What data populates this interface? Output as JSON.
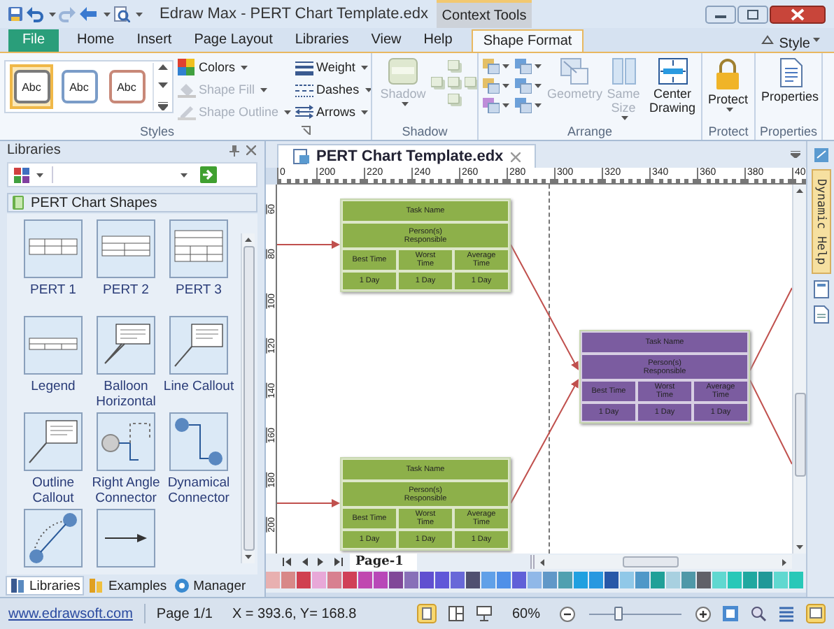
{
  "window": {
    "title": "Edraw Max - PERT Chart Template.edx",
    "context_tab": "Context Tools"
  },
  "ribbon_tabs": [
    {
      "label": "File",
      "kind": "file",
      "selected": false
    },
    {
      "label": "Home",
      "kind": "tab",
      "selected": false
    },
    {
      "label": "Insert",
      "kind": "tab",
      "selected": false
    },
    {
      "label": "Page Layout",
      "kind": "tab",
      "selected": false
    },
    {
      "label": "Libraries",
      "kind": "tab",
      "selected": false
    },
    {
      "label": "View",
      "kind": "tab",
      "selected": false
    },
    {
      "label": "Help",
      "kind": "tab",
      "selected": false
    },
    {
      "label": "Shape Format",
      "kind": "tab",
      "selected": true
    }
  ],
  "style_menu": "Style",
  "ribbon": {
    "groups": [
      {
        "kind": "styles",
        "label": "Styles",
        "presets": [
          {
            "text": "Abc",
            "color": "#7a7a7a",
            "selected": true
          },
          {
            "text": "Abc",
            "color": "#7a9cc8",
            "selected": false
          },
          {
            "text": "Abc",
            "color": "#c88878",
            "selected": false
          }
        ],
        "items": [
          {
            "label": "Colors",
            "kind": "colors",
            "disabled": false,
            "dropdown": true
          },
          {
            "label": "Shape Fill",
            "kind": "fill",
            "disabled": true,
            "dropdown": true
          },
          {
            "label": "Shape Outline",
            "kind": "outline",
            "disabled": true,
            "dropdown": true
          },
          {
            "label": "Weight",
            "kind": "weight",
            "disabled": false,
            "dropdown": true
          },
          {
            "label": "Dashes",
            "kind": "dashes",
            "disabled": false,
            "dropdown": true
          },
          {
            "label": "Arrows",
            "kind": "arrows",
            "disabled": false,
            "dropdown": true
          }
        ]
      },
      {
        "kind": "shadow",
        "label": "Shadow",
        "items": [
          {
            "label": "Shadow",
            "kind": "shadow",
            "disabled": true,
            "dropdown": true
          }
        ]
      },
      {
        "kind": "arrange",
        "label": "Arrange",
        "items": [
          {
            "label": "Geometry",
            "kind": "geometry",
            "disabled": true,
            "dropdown": false
          },
          {
            "label": "Same Size",
            "kind": "same-size",
            "disabled": true,
            "dropdown": true
          },
          {
            "label": "Center Drawing",
            "kind": "center",
            "disabled": false,
            "dropdown": false
          }
        ]
      },
      {
        "kind": "protect",
        "label": "Protect",
        "items": [
          {
            "label": "Protect",
            "kind": "lock",
            "disabled": false,
            "dropdown": true
          }
        ]
      },
      {
        "kind": "properties",
        "label": "Properties",
        "items": [
          {
            "label": "Properties",
            "kind": "doc",
            "disabled": false,
            "dropdown": false
          }
        ]
      }
    ]
  },
  "libraries": {
    "title": "Libraries",
    "section": "PERT Chart Shapes",
    "shapes": [
      {
        "label": "PERT 1",
        "kind": "pert1"
      },
      {
        "label": "PERT 2",
        "kind": "pert2"
      },
      {
        "label": "PERT 3",
        "kind": "pert3"
      },
      {
        "label": "Legend",
        "kind": "legend"
      },
      {
        "label": "Balloon Horizontal",
        "kind": "balloon"
      },
      {
        "label": "Line Callout",
        "kind": "callout"
      },
      {
        "label": "Outline Callout",
        "kind": "callout"
      },
      {
        "label": "Right Angle Connector",
        "kind": "right-angle"
      },
      {
        "label": "Dynamical Connector",
        "kind": "dynamic"
      },
      {
        "kind": "line"
      },
      {
        "kind": "arrow"
      }
    ],
    "tabs": [
      {
        "label": "Libraries",
        "selected": true
      },
      {
        "label": "Examples",
        "selected": false
      },
      {
        "label": "Manager",
        "selected": false
      }
    ]
  },
  "document": {
    "tab": "PERT Chart Template.edx",
    "h_ruler": [
      "0",
      "200",
      "220",
      "240",
      "260",
      "280",
      "300",
      "320",
      "340",
      "360",
      "380",
      "40"
    ],
    "v_ruler": [
      "60",
      "80",
      "100",
      "120",
      "140",
      "160",
      "180",
      "200"
    ],
    "nodes": [
      {
        "color": "#8db04a",
        "title": "Task Name",
        "responsible": "Person(s) Responsible",
        "headers": [
          "Best Time",
          "Worst Time",
          "Average Time"
        ],
        "values": [
          "1 Day",
          "1 Day",
          "1 Day"
        ]
      },
      {
        "color": "#8db04a",
        "title": "Task Name",
        "responsible": "Person(s) Responsible",
        "headers": [
          "Best Time",
          "Worst Time",
          "Average Time"
        ],
        "values": [
          "1 Day",
          "1 Day",
          "1 Day"
        ]
      },
      {
        "color": "#7b5ca0",
        "title": "Task Name",
        "responsible": "Person(s) Responsible",
        "headers": [
          "Best Time",
          "Worst Time",
          "Average Time"
        ],
        "values": [
          "1 Day",
          "1 Day",
          "1 Day"
        ]
      }
    ],
    "page_tab": "Page-1"
  },
  "palette": [
    {
      "color": "#e8b0b0"
    },
    {
      "color": "#d88888"
    },
    {
      "color": "#d04050"
    },
    {
      "color": "#e8a8d8"
    },
    {
      "color": "#d88090"
    },
    {
      "color": "#d04058"
    },
    {
      "color": "#c048b0"
    },
    {
      "color": "#b848b8"
    },
    {
      "color": "#804898"
    },
    {
      "color": "#8870b8"
    },
    {
      "color": "#6050d0"
    },
    {
      "color": "#6058d8"
    },
    {
      "color": "#6868d8"
    },
    {
      "color": "#505070"
    },
    {
      "color": "#60a0e8"
    },
    {
      "color": "#5090e8"
    },
    {
      "color": "#6060d8"
    },
    {
      "color": "#90b8e8"
    },
    {
      "color": "#6098c8"
    },
    {
      "color": "#50a0b0"
    },
    {
      "color": "#20a0e0"
    },
    {
      "color": "#2898e0"
    },
    {
      "color": "#2858a8"
    },
    {
      "color": "#90c8e8"
    },
    {
      "color": "#5098c8"
    },
    {
      "color": "#20a098"
    },
    {
      "color": "#a8d0e0"
    },
    {
      "color": "#5098a8"
    },
    {
      "color": "#606068"
    },
    {
      "color": "#60d8d0"
    },
    {
      "color": "#28c8b8"
    },
    {
      "color": "#20a8a0"
    },
    {
      "color": "#209898"
    },
    {
      "color": "#60d8d0"
    },
    {
      "color": "#28c8b8"
    }
  ],
  "side_panel": {
    "tab": "Dynamic Help"
  },
  "status_bar": {
    "link": "www.edrawsoft.com",
    "page": "Page 1/1",
    "coords": "X = 393.6, Y= 168.8",
    "zoom": "60%"
  }
}
